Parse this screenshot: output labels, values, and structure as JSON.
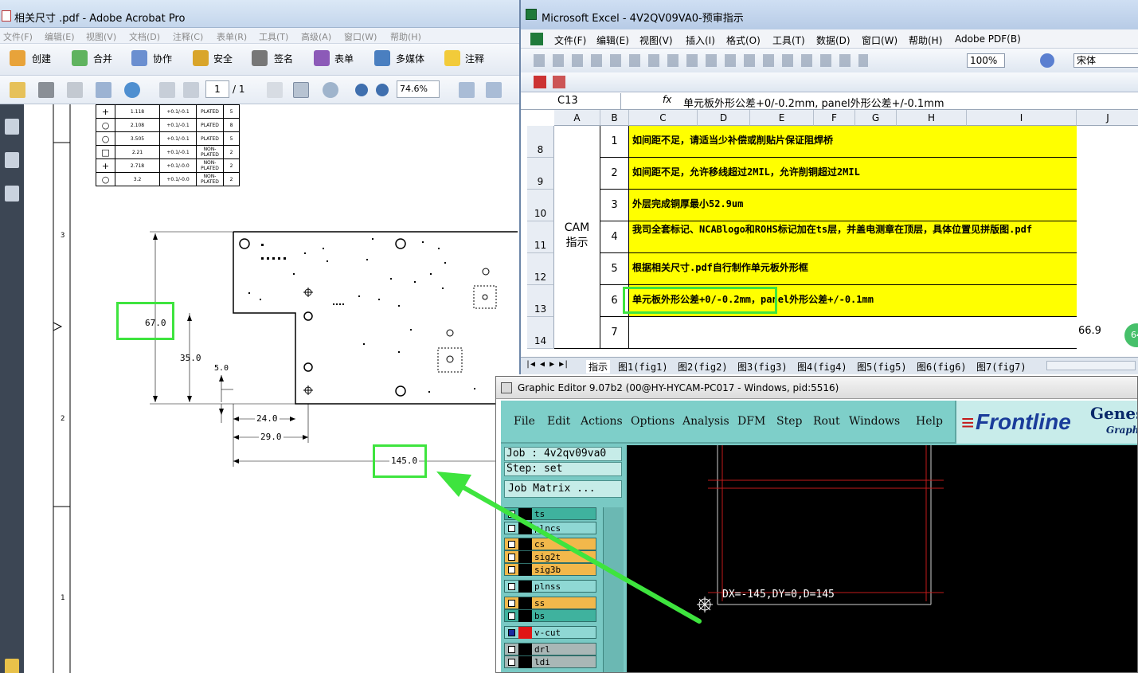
{
  "acrobat": {
    "title": "相关尺寸 .pdf - Adobe Acrobat Pro",
    "menu": [
      "文件(F)",
      "编辑(E)",
      "视图(V)",
      "文档(D)",
      "注释(C)",
      "表单(R)",
      "工具(T)",
      "高级(A)",
      "窗口(W)",
      "帮助(H)"
    ],
    "toolbar": [
      "创建",
      "合并",
      "协作",
      "安全",
      "签名",
      "表单",
      "多媒体",
      "注释"
    ],
    "page_number": "1",
    "page_total": "/ 1",
    "zoom": "74.6%",
    "drill_table": [
      [
        "+",
        "1.118",
        "+0.1/-0.1",
        "PLATED",
        "5"
      ],
      [
        "○",
        "2.108",
        "+0.1/-0.1",
        "PLATED",
        "8"
      ],
      [
        "○",
        "3.505",
        "+0.1/-0.1",
        "PLATED",
        "5"
      ],
      [
        "□",
        "2.21",
        "+0.1/-0.1",
        "NON-PLATED",
        "2"
      ],
      [
        "+",
        "2.718",
        "+0.1/-0.0",
        "NON-PLATED",
        "2"
      ],
      [
        "○",
        "3.2",
        "+0.1/-0.0",
        "NON-PLATED",
        "2"
      ]
    ],
    "dims": {
      "d67": "67.0",
      "d35": "35.0",
      "d5": "5.0",
      "d24": "24.0",
      "d29": "29.0",
      "d145": "145.0"
    },
    "margin_nums": [
      "3",
      "2",
      "1"
    ]
  },
  "excel": {
    "title": "Microsoft Excel - 4V2QV09VA0-预审指示",
    "menu": [
      "文件(F)",
      "编辑(E)",
      "视图(V)",
      "插入(I)",
      "格式(O)",
      "工具(T)",
      "数据(D)",
      "窗口(W)",
      "帮助(H)",
      "Adobe PDF(B)"
    ],
    "zoom": "100%",
    "font": "宋体",
    "cell_ref": "C13",
    "formula": "单元板外形公差+0/-0.2mm, panel外形公差+/-0.1mm",
    "columns": [
      "A",
      "B",
      "C",
      "D",
      "E",
      "F",
      "G",
      "H",
      "I",
      "J"
    ],
    "rows": [
      "8",
      "9",
      "10",
      "11",
      "12",
      "13",
      "14"
    ],
    "group_label": "CAM\n指示",
    "items": [
      {
        "num": "1",
        "text": "如间距不足，请适当少补偿或削贴片保证阻焊桥"
      },
      {
        "num": "2",
        "text": "如间距不足，允许移线超过2MIL，允许削铜超过2MIL"
      },
      {
        "num": "3",
        "text": "外层完成铜厚最小52.9um"
      },
      {
        "num": "4",
        "text": "我司全套标记、NCABlogo和ROHS标记加在ts层，并盖电测章在顶层，具体位置见拼版图.pdf"
      },
      {
        "num": "5",
        "text": "根据相关尺寸.pdf自行制作单元板外形框"
      },
      {
        "num": "6",
        "text": "单元板外形公差+0/-0.2mm，panel外形公差+/-0.1mm"
      },
      {
        "num": "7",
        "text": ""
      }
    ],
    "j14": "66.9",
    "badge": "64",
    "tabs": [
      "指示",
      "图1(fig1)",
      "图2(fig2)",
      "图3(fig3)",
      "图4(fig4)",
      "图5(fig5)",
      "图6(fig6)",
      "图7(fig7)"
    ]
  },
  "genesis": {
    "title": "Graphic Editor 9.07b2 (00@HY-HYCAM-PC017 - Windows, pid:5516)",
    "menu": [
      "File",
      "Edit",
      "Actions",
      "Options",
      "Analysis",
      "DFM",
      "Step",
      "Rout",
      "Windows",
      "Help"
    ],
    "logo": "Frontline",
    "logo_sub1": "Genes",
    "logo_sub2": "Graph",
    "job": "Job  : 4v2qv09va0",
    "step": "Step: set",
    "job_matrix": "Job Matrix ...",
    "layers": [
      {
        "name": "ts",
        "color": "#3fb29e"
      },
      {
        "name": "plncs",
        "color": "#8fd8d4"
      },
      {
        "name": "cs",
        "color": "#f2b84b"
      },
      {
        "name": "sig2t",
        "color": "#f2b84b"
      },
      {
        "name": "sig3b",
        "color": "#f2b84b"
      },
      {
        "name": "plnss",
        "color": "#8fd8d4"
      },
      {
        "name": "ss",
        "color": "#f2b84b"
      },
      {
        "name": "bs",
        "color": "#3fb29e"
      },
      {
        "name": "v-cut",
        "color": "#8fd8d4"
      },
      {
        "name": "drl",
        "color": "#a9b7b6"
      },
      {
        "name": "ldi",
        "color": "#a9b7b6"
      }
    ],
    "measure": "DX=-145,DY=0,D=145"
  }
}
